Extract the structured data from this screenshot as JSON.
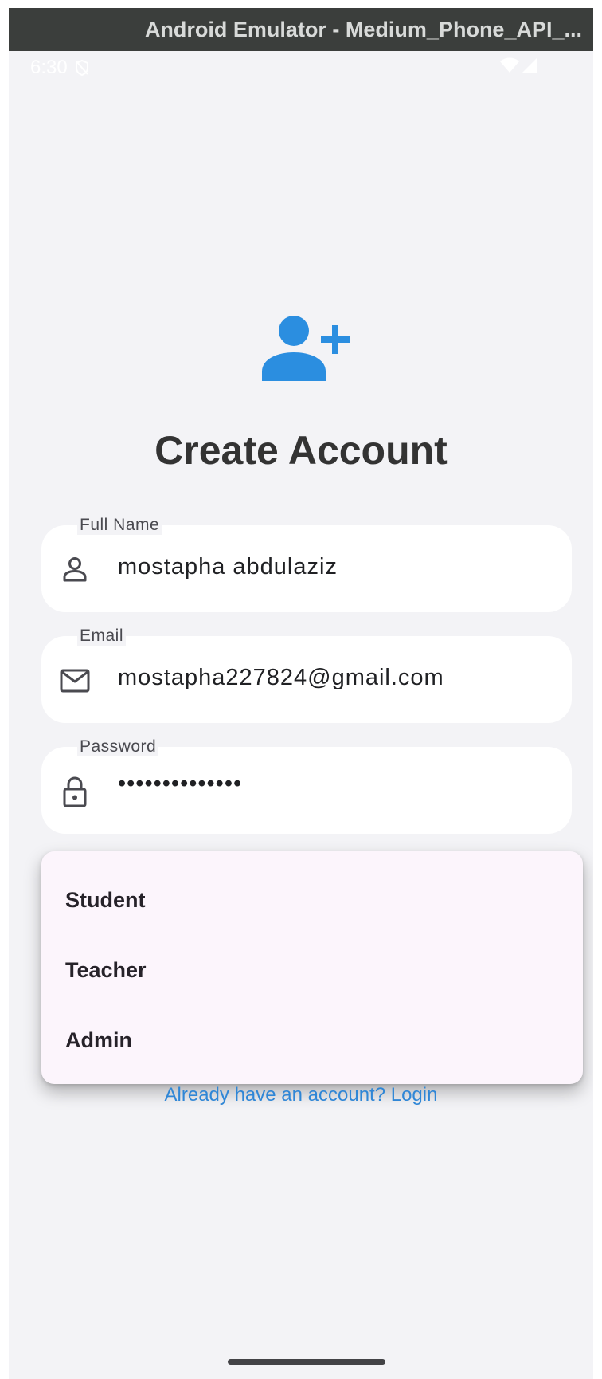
{
  "window": {
    "title": "Android Emulator - Medium_Phone_API_..."
  },
  "statusbar": {
    "time": "6:30",
    "left_icon": "shield-off-icon",
    "right_icons": [
      "wifi-icon",
      "cell-signal-icon"
    ]
  },
  "header": {
    "icon": "person-add-icon",
    "title": "Create Account"
  },
  "form": {
    "full_name": {
      "label": "Full Name",
      "value": "mostapha abdulaziz",
      "icon": "person-icon"
    },
    "email": {
      "label": "Email",
      "value": "mostapha227824@gmail.com",
      "icon": "mail-icon"
    },
    "password": {
      "label": "Password",
      "value": "••••••••••••••",
      "icon": "lock-icon"
    }
  },
  "role_dropdown": {
    "options": [
      "Student",
      "Teacher",
      "Admin"
    ]
  },
  "footer": {
    "login_link": "Already have an account? Login"
  },
  "colors": {
    "accent": "#2b8ee0",
    "link": "#2f86d6",
    "background": "#f3f3f6",
    "menu_background": "#fcf5fc"
  }
}
